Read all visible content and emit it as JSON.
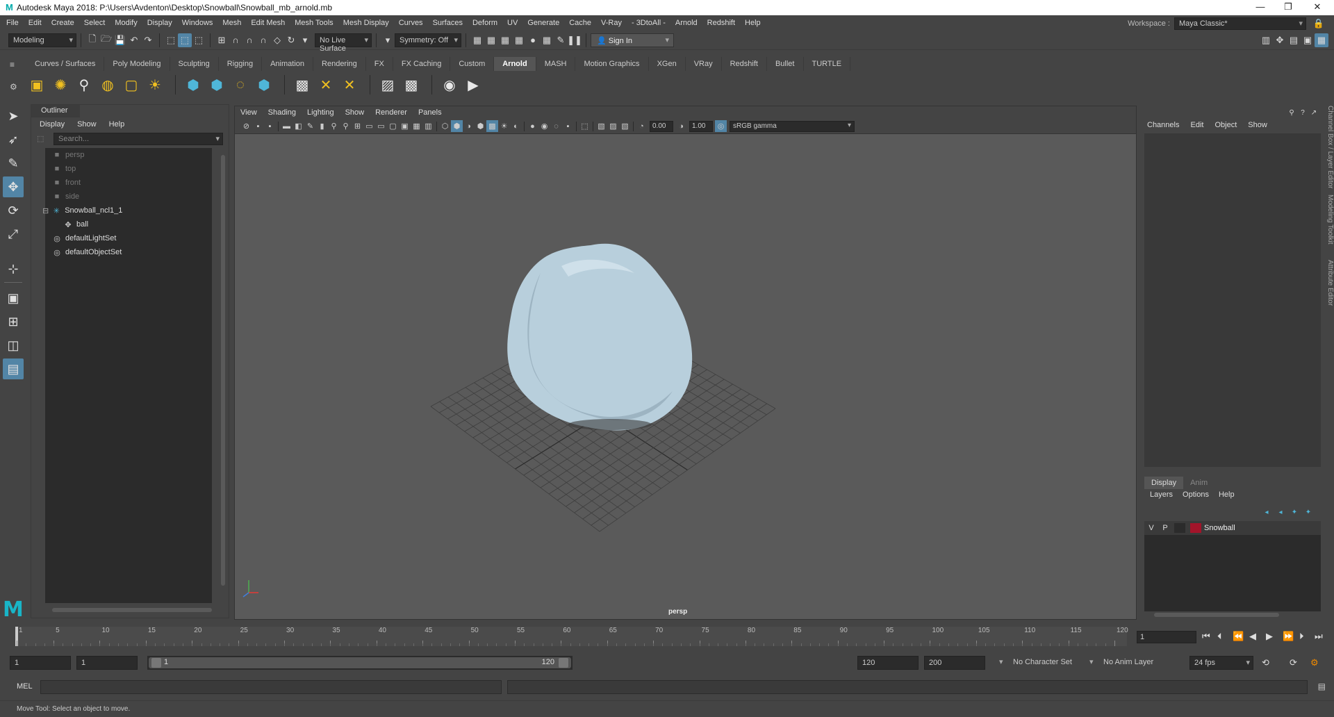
{
  "window": {
    "title": "Autodesk Maya 2018: P:\\Users\\Avdenton\\Desktop\\Snowball\\Snowball_mb_arnold.mb",
    "logo": "M"
  },
  "menubar": {
    "items": [
      "File",
      "Edit",
      "Create",
      "Select",
      "Modify",
      "Display",
      "Windows",
      "Mesh",
      "Edit Mesh",
      "Mesh Tools",
      "Mesh Display",
      "Curves",
      "Surfaces",
      "Deform",
      "UV",
      "Generate",
      "Cache",
      "V-Ray",
      "- 3DtoAll -",
      "Arnold",
      "Redshift",
      "Help"
    ],
    "workspace_label": "Workspace :",
    "workspace_value": "Maya Classic*"
  },
  "statusline": {
    "menuset": "Modeling",
    "live_surface": "No Live Surface",
    "symmetry": "Symmetry: Off",
    "sign_in": "Sign In"
  },
  "shelf": {
    "tabs": [
      "Curves / Surfaces",
      "Poly Modeling",
      "Sculpting",
      "Rigging",
      "Animation",
      "Rendering",
      "FX",
      "FX Caching",
      "Custom",
      "Arnold",
      "MASH",
      "Motion Graphics",
      "XGen",
      "VRay",
      "Redshift",
      "Bullet",
      "TURTLE"
    ],
    "active_tab": "Arnold"
  },
  "outliner": {
    "title": "Outliner",
    "menu": [
      "Display",
      "Show",
      "Help"
    ],
    "search_placeholder": "Search...",
    "items": [
      {
        "label": "persp",
        "icon": "camera-icon",
        "indent": 0,
        "dim": true
      },
      {
        "label": "top",
        "icon": "camera-icon",
        "indent": 0,
        "dim": true
      },
      {
        "label": "front",
        "icon": "camera-icon",
        "indent": 0,
        "dim": true
      },
      {
        "label": "side",
        "icon": "camera-icon",
        "indent": 0,
        "dim": true
      },
      {
        "label": "Snowball_ncl1_1",
        "icon": "joint-icon",
        "indent": 0,
        "dim": false
      },
      {
        "label": "ball",
        "icon": "mesh-icon",
        "indent": 1,
        "dim": false
      },
      {
        "label": "defaultLightSet",
        "icon": "set-icon",
        "indent": 0,
        "dim": false
      },
      {
        "label": "defaultObjectSet",
        "icon": "set-icon",
        "indent": 0,
        "dim": false
      }
    ]
  },
  "viewport": {
    "menu": [
      "View",
      "Shading",
      "Lighting",
      "Show",
      "Renderer",
      "Panels"
    ],
    "exposure": "0.00",
    "gamma": "1.00",
    "color_space": "sRGB gamma",
    "camera": "persp",
    "object_color": "#b8cfdc",
    "grid_color": "#3e3e3e"
  },
  "channelbox": {
    "menu": [
      "Channels",
      "Edit",
      "Object",
      "Show"
    ],
    "side_tabs": [
      "Channel Box / Layer Editor",
      "Modeling Toolkit",
      "Attribute Editor"
    ]
  },
  "layers": {
    "tabs": [
      "Display",
      "Anim"
    ],
    "active_tab": "Display",
    "menu": [
      "Layers",
      "Options",
      "Help"
    ],
    "items": [
      {
        "v": "V",
        "p": "P",
        "name": "Snowball",
        "color": "#a3142a"
      }
    ]
  },
  "timeslider": {
    "ticks": [
      "1",
      "5",
      "10",
      "15",
      "20",
      "25",
      "30",
      "35",
      "40",
      "45",
      "50",
      "55",
      "60",
      "65",
      "70",
      "75",
      "80",
      "85",
      "90",
      "95",
      "100",
      "105",
      "110",
      "115",
      "120"
    ],
    "current_frame": "1"
  },
  "rangeslider": {
    "start": "1",
    "playback_start": "1",
    "range_start": "1",
    "range_end": "120",
    "playback_end": "120",
    "end": "200",
    "character_set": "No Character Set",
    "anim_layer": "No Anim Layer",
    "fps": "24 fps"
  },
  "cmdline": {
    "label": "MEL"
  },
  "helpline": {
    "text": "Move Tool: Select an object to move."
  }
}
